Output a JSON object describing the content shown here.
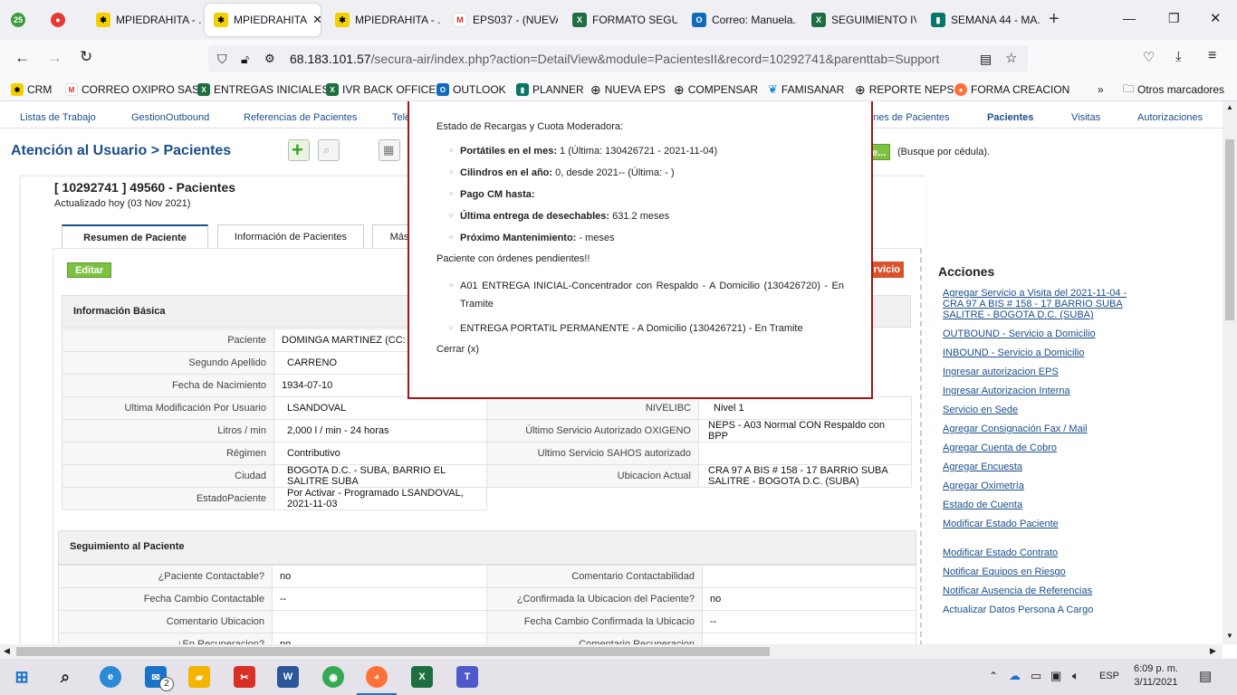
{
  "browser": {
    "tabs": [
      {
        "label": "",
        "icon": "counter-badge-icon"
      },
      {
        "label": "",
        "icon": "notification-icon"
      },
      {
        "label": "MPIEDRAHITA - ...",
        "icon": "secura-air-icon"
      },
      {
        "label": "MPIEDRAHITA",
        "icon": "secura-air-icon"
      },
      {
        "label": "MPIEDRAHITA - ...",
        "icon": "secura-air-icon"
      },
      {
        "label": "EPS037 - (NUEVA...",
        "icon": "gmail-icon"
      },
      {
        "label": "FORMATO SEGU...",
        "icon": "excel-icon"
      },
      {
        "label": "Correo: Manuela...",
        "icon": "outlook-icon"
      },
      {
        "label": "SEGUIMIENTO IV...",
        "icon": "excel-icon"
      },
      {
        "label": "SEMANA 44 - MA...",
        "icon": "planner-icon"
      }
    ],
    "tab_badge": "25",
    "url_host": "68.183.101.57",
    "url_path": "/secura-air/index.php?action=DetailView&module=PacientesII&record=10292741&parenttab=Support",
    "bookmarks": [
      {
        "label": "CRM",
        "icon": "secura-air-icon"
      },
      {
        "label": "CORREO OXIPRO SAS",
        "icon": "gmail-icon"
      },
      {
        "label": "ENTREGAS INICIALES",
        "icon": "excel-icon"
      },
      {
        "label": "IVR BACK OFFICE",
        "icon": "excel-icon"
      },
      {
        "label": "OUTLOOK",
        "icon": "outlook-icon"
      },
      {
        "label": "PLANNER",
        "icon": "planner-icon"
      },
      {
        "label": "NUEVA EPS",
        "icon": "globe-icon"
      },
      {
        "label": "COMPENSAR",
        "icon": "globe-icon"
      },
      {
        "label": "FAMISANAR",
        "icon": "famisanar-icon"
      },
      {
        "label": "REPORTE NEPS",
        "icon": "globe-icon"
      },
      {
        "label": "FORMA CREACION",
        "icon": "firefox-icon"
      }
    ],
    "other_bookmarks": "Otros marcadores"
  },
  "topnav": {
    "items": [
      "Listas de Trabajo",
      "GestionOutbound",
      "Referencias de Pacientes",
      "Telé",
      "ones de Pacientes",
      "Pacientes",
      "Visitas",
      "Autorizaciones"
    ]
  },
  "header": {
    "title": "Atención al Usuario > Pacientes",
    "search_button": "e...",
    "search_hint": "(Busque por cédula)."
  },
  "record": {
    "title": "[ 10292741 ] 49560 - Pacientes",
    "updated": "Actualizado hoy (03 Nov 2021)",
    "tabs": [
      "Resumen de Paciente",
      "Información de Pacientes",
      "Más"
    ],
    "edit_button": "Editar",
    "service_button": "rvicio"
  },
  "info_basica": {
    "title": "Información Básica",
    "left_rows": [
      {
        "label": "Paciente",
        "value": "DOMINGA MARTINEZ (CC: 2"
      },
      {
        "label": "Segundo Apellido",
        "value": "CARRENO"
      },
      {
        "label": "Fecha de Nacimiento",
        "value": "1934-07-10"
      },
      {
        "label": "Ultima Modificación Por Usuario",
        "value": "LSANDOVAL"
      },
      {
        "label": "Litros / min",
        "value": "2,000 l / min - 24 horas"
      },
      {
        "label": "Régimen",
        "value": "Contributivo"
      },
      {
        "label": "Ciudad",
        "value": "BOGOTA D.C. - SUBA, BARRIO EL SALITRE SUBA"
      },
      {
        "label": "EstadoPaciente",
        "value": "Por Activar - Programado LSANDOVAL, 2021-11-03"
      }
    ],
    "right_rows": [
      {
        "label": "NIVELIBC",
        "value": "Nivel 1"
      },
      {
        "label": "Último Servicio Autorizado OXIGENO",
        "value": "NEPS - A03 Normal CON Respaldo con BPP"
      },
      {
        "label": "Ultimo Servicio SAHOS autorizado",
        "value": ""
      },
      {
        "label": "Ubicacion Actual",
        "value": "CRA 97 A BIS # 158 - 17 BARRIO SUBA SALITRE - BOGOTA D.C. (SUBA)"
      }
    ]
  },
  "seguimiento": {
    "title": "Seguimiento al Paciente",
    "rows": [
      {
        "l1": "¿Paciente Contactable?",
        "v1": "no",
        "l2": "Comentario Contactabilidad",
        "v2": ""
      },
      {
        "l1": "Fecha Cambio Contactable",
        "v1": "--",
        "l2": "¿Confirmada la Ubicacion del Paciente?",
        "v2": "no"
      },
      {
        "l1": "Comentario Ubicacion",
        "v1": "",
        "l2": "Fecha Cambio Confirmada la Ubicacio",
        "v2": "--"
      },
      {
        "l1": "¿En Recuperacion?",
        "v1": "no",
        "l2": "Comentario Recuperacion",
        "v2": ""
      }
    ]
  },
  "acciones": {
    "title": "Acciones",
    "links": [
      "Agregar Servicio a Visita del 2021-11-04 - CRA 97 A BIS # 158 - 17 BARRIO SUBA SALITRE - BOGOTA D.C. (SUBA)",
      "OUTBOUND - Servicio a Domicilio",
      "INBOUND - Servicio a Domicilio",
      "Ingresar autorizacion EPS",
      "Ingresar Autorizacion Interna",
      "Servicio en Sede",
      "Agregar Consignación Fax / Mail",
      "Agregar Cuenta de Cobro",
      "Agregar Encuesta",
      "Agregar Oximetría",
      "Estado de Cuenta",
      "Modificar Estado Paciente",
      "Modificar Estado Contrato",
      "Notificar Equipos en Riesgo",
      "Notificar Ausencia de Referencias",
      "Actualizar Datos Persona A Cargo"
    ]
  },
  "popup": {
    "heading": "Estado de Recargas y Cuota Moderadora:",
    "items": [
      {
        "bold": "Portátiles en el mes:",
        "text": " 1 (Última: 130426721 - 2021-11-04)"
      },
      {
        "bold": "Cilindros en el año:",
        "text": " 0, desde 2021-- (Última: - )"
      },
      {
        "bold": "Pago CM hasta:",
        "text": ""
      },
      {
        "bold": "Última entrega de desechables:",
        "text": " 631.2 meses"
      },
      {
        "bold": "Próximo Mantenimiento:",
        "text": " - meses"
      }
    ],
    "pending_heading": "Paciente con órdenes pendientes!!",
    "pending": [
      "A01 ENTREGA INICIAL-Concentrador con Respaldo - A Domicilio (130426720) - En Tramite",
      "ENTREGA PORTATIL PERMANENTE - A Domicilio (130426721) - En Tramite"
    ],
    "close": "Cerrar (x)"
  },
  "taskbar": {
    "lang": "ESP",
    "time": "6:09 p. m.",
    "date": "3/11/2021",
    "mail_badge": "2"
  },
  "colors": {
    "link": "#1a4f8b",
    "popup_border": "#a11111",
    "edit_btn": "#7dc142",
    "service_btn": "#d9532c"
  }
}
